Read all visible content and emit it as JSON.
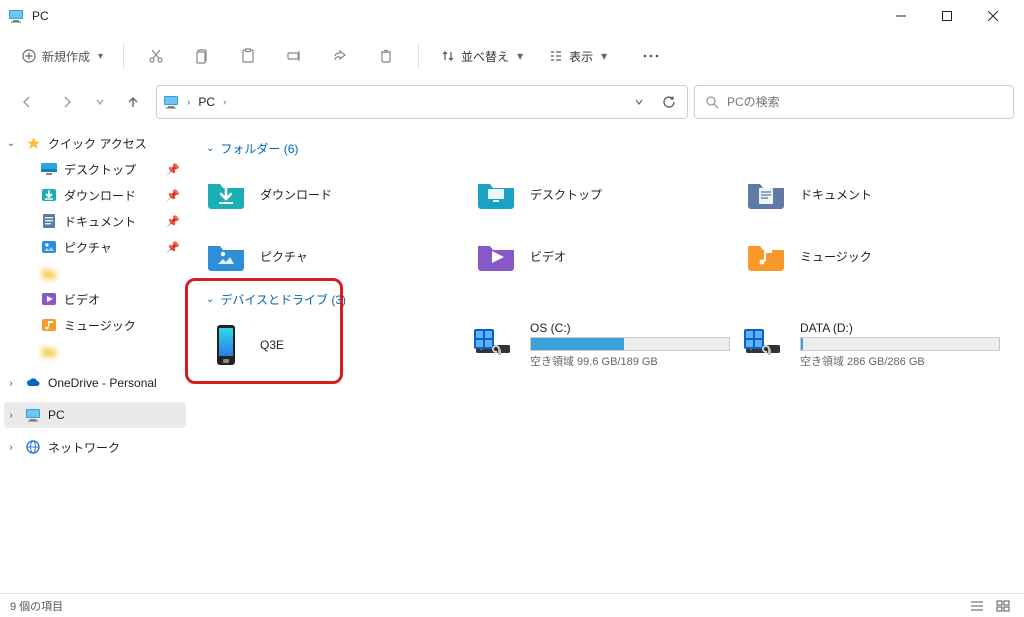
{
  "window": {
    "title": "PC"
  },
  "toolbar": {
    "new_label": "新規作成",
    "sort_label": "並べ替え",
    "view_label": "表示"
  },
  "breadcrumb": {
    "root": "PC"
  },
  "search": {
    "placeholder": "PCの検索"
  },
  "sidebar": {
    "quick_access": "クイック アクセス",
    "items": [
      {
        "label": "デスクトップ",
        "icon": "desktop"
      },
      {
        "label": "ダウンロード",
        "icon": "download"
      },
      {
        "label": "ドキュメント",
        "icon": "document"
      },
      {
        "label": "ピクチャ",
        "icon": "pictures"
      },
      {
        "label": "",
        "icon": "folder",
        "blur": true
      },
      {
        "label": "ビデオ",
        "icon": "video"
      },
      {
        "label": "ミュージック",
        "icon": "music"
      },
      {
        "label": "",
        "icon": "folder",
        "blur": true
      }
    ],
    "onedrive": "OneDrive - Personal",
    "this_pc": "PC",
    "network": "ネットワーク"
  },
  "groups": {
    "folders": {
      "title": "フォルダー",
      "count": 6
    },
    "devices": {
      "title": "デバイスとドライブ",
      "count": 3
    }
  },
  "folders": [
    {
      "name": "ダウンロード",
      "icon": "download"
    },
    {
      "name": "デスクトップ",
      "icon": "desktop"
    },
    {
      "name": "ドキュメント",
      "icon": "document"
    },
    {
      "name": "ピクチャ",
      "icon": "pictures"
    },
    {
      "name": "ビデオ",
      "icon": "video"
    },
    {
      "name": "ミュージック",
      "icon": "music"
    }
  ],
  "devices": [
    {
      "name": "Q3E",
      "kind": "phone"
    },
    {
      "name": "OS (C:)",
      "kind": "drive",
      "free": "99.6 GB",
      "total": "189 GB",
      "free_label_prefix": "空き領域 ",
      "fill_pct": 47
    },
    {
      "name": "DATA (D:)",
      "kind": "drive",
      "free": "286 GB",
      "total": "286 GB",
      "free_label_prefix": "空き領域 ",
      "fill_pct": 1
    }
  ],
  "status": {
    "count_label": "9 個の項目"
  },
  "colors": {
    "folderBlue": "#1aa1c4",
    "folderTeal": "#1aaeb5",
    "folderOrange": "#f89a2a",
    "folderPurple": "#8659c6",
    "highlight": "#d41f1f"
  }
}
